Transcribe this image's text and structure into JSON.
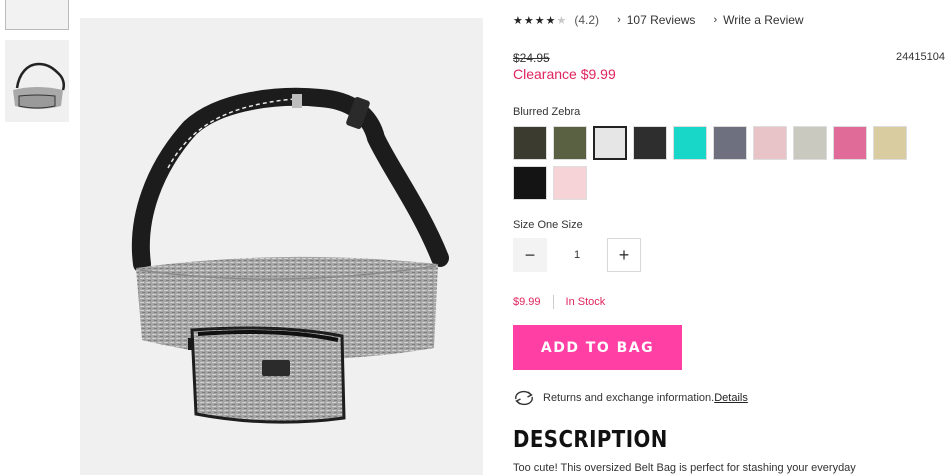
{
  "rating": {
    "stars_filled": 4,
    "stars_total": 5,
    "score": "(4.2)",
    "reviews_link": "107 Reviews",
    "write_review_link": "Write a Review"
  },
  "price": {
    "original": "$24.95",
    "clearance": "Clearance $9.99",
    "sku": "24415104"
  },
  "color": {
    "selected_name": "Blurred Zebra",
    "swatches": [
      {
        "name": "black-camo",
        "color": "#3b3b30"
      },
      {
        "name": "green-camo",
        "color": "#5a6142"
      },
      {
        "name": "blurred-zebra",
        "color": "#b9b9b9"
      },
      {
        "name": "black-marble",
        "color": "#2e2e2e"
      },
      {
        "name": "turquoise",
        "color": "#19d7c8"
      },
      {
        "name": "grey-logo",
        "color": "#6e7080"
      },
      {
        "name": "pink-glitter",
        "color": "#e8c4c8"
      },
      {
        "name": "silver-glitter",
        "color": "#c9c9c0"
      },
      {
        "name": "hot-pink-glitter",
        "color": "#e06a98"
      },
      {
        "name": "gold-glitter",
        "color": "#d9cca0"
      },
      {
        "name": "black-quilted",
        "color": "#141414"
      },
      {
        "name": "blush-quilted",
        "color": "#f6d3d6"
      }
    ]
  },
  "size": {
    "label": "Size One Size"
  },
  "quantity": {
    "minus": "−",
    "value": "1",
    "plus": "+"
  },
  "stock": {
    "price": "$9.99",
    "status": "In Stock"
  },
  "add_to_bag": "ADD TO BAG",
  "returns": {
    "text": "Returns and exchange information.",
    "link": "Details"
  },
  "description": {
    "title": "DESCRIPTION",
    "text": "Too cute! This oversized Belt Bag is perfect for stashing your everyday"
  },
  "colors": {
    "accent_pink": "#ff3fa4",
    "clearance_red": "#e0245e"
  }
}
